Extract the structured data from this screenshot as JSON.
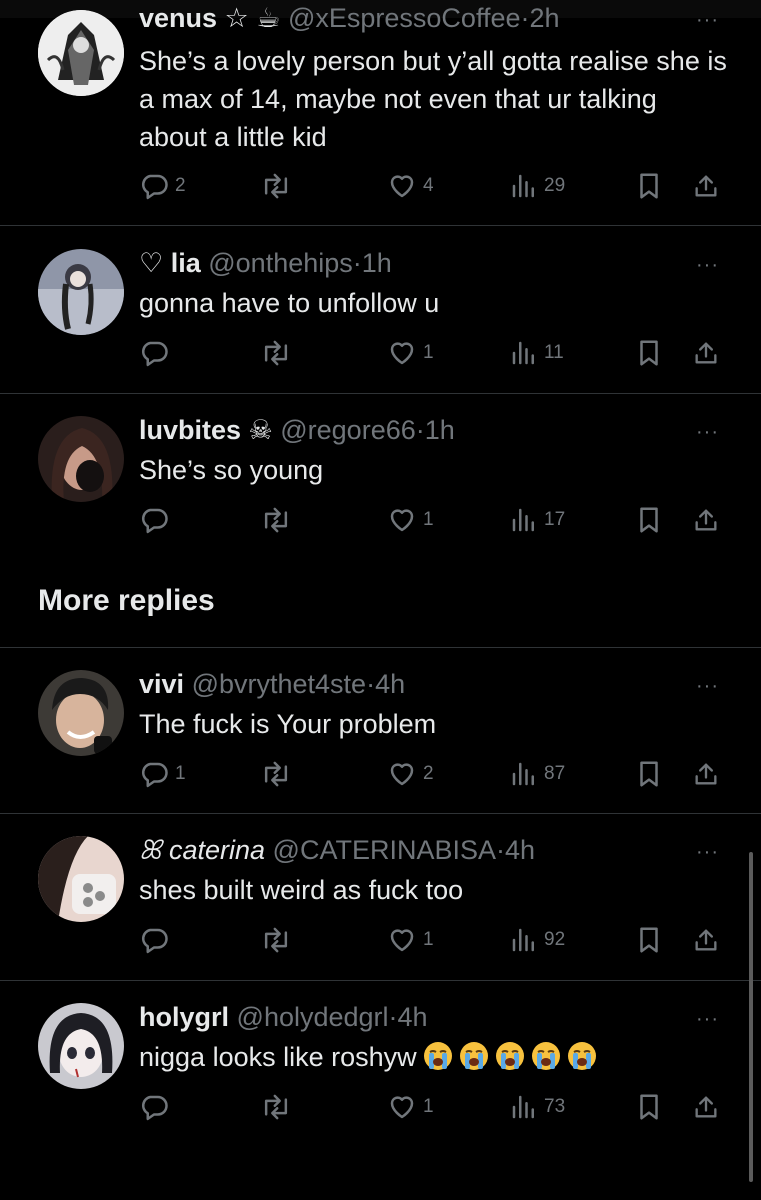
{
  "tweets": [
    {
      "name": "venus ☆ ☕",
      "handle": "@xEspressoCoffee",
      "sep": "·",
      "time": "2h",
      "text": "She’s a lovely person but y’all gotta realise she is a max of 14, maybe not even that ur talking about a little kid",
      "replies": "2",
      "retweets": "",
      "likes": "4",
      "views": "29"
    },
    {
      "name": "♡ lia",
      "handle": "@onthehips",
      "sep": "·",
      "time": "1h",
      "text": "gonna have to unfollow u",
      "replies": "",
      "retweets": "",
      "likes": "1",
      "views": "11"
    },
    {
      "name": "luvbites ☠",
      "handle": "@regore66",
      "sep": "·",
      "time": "1h",
      "text": "She’s so young",
      "replies": "",
      "retweets": "",
      "likes": "1",
      "views": "17"
    },
    {
      "name": "vivi",
      "handle": "@bvrythet4ste",
      "sep": "·",
      "time": "4h",
      "text": "The fuck is Your problem",
      "replies": "1",
      "retweets": "",
      "likes": "2",
      "views": "87"
    },
    {
      "name": "ꕤ caterina",
      "handle": "@CATERINABISA",
      "sep": "·",
      "time": "4h",
      "text": "shes built weird as fuck too",
      "replies": "",
      "retweets": "",
      "likes": "1",
      "views": "92"
    },
    {
      "name": "holygrl",
      "handle": "@holydedgrl",
      "sep": "·",
      "time": "4h",
      "text": "nigga looks like roshyw",
      "replies": "",
      "retweets": "",
      "likes": "1",
      "views": "73"
    }
  ],
  "more_replies_label": "More replies",
  "more_icon": "···",
  "icons": {
    "reply": "reply-icon",
    "retweet": "retweet-icon",
    "like": "heart-icon",
    "views": "views-icon",
    "bookmark": "bookmark-icon",
    "share": "share-icon",
    "crying": "loudly-crying-face-icon"
  },
  "colors": {
    "background": "#000000",
    "text": "#e7e9ea",
    "secondary": "#71767b",
    "divider": "#2f3336"
  }
}
